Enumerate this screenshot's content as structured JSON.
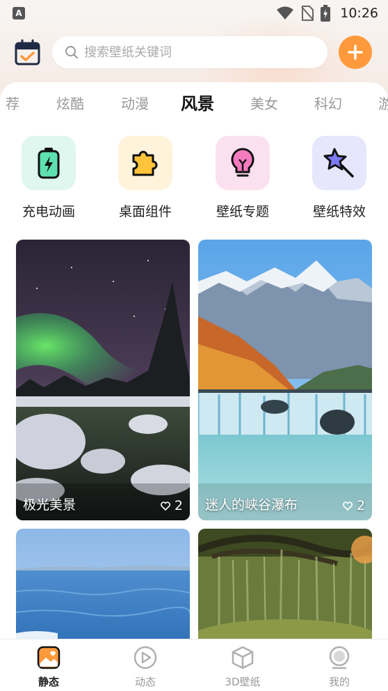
{
  "status_bar": {
    "time": "10:26",
    "app_badge": "A"
  },
  "search": {
    "placeholder": "搜索壁纸关键词",
    "value": ""
  },
  "tabs": [
    {
      "label": "荐",
      "active": false
    },
    {
      "label": "炫酷",
      "active": false
    },
    {
      "label": "动漫",
      "active": false
    },
    {
      "label": "风景",
      "active": true
    },
    {
      "label": "美女",
      "active": false
    },
    {
      "label": "科幻",
      "active": false
    },
    {
      "label": "游",
      "active": false
    }
  ],
  "quick": [
    {
      "label": "充电动画",
      "icon": "battery-charging-icon",
      "bg": "#dff7ee"
    },
    {
      "label": "桌面组件",
      "icon": "puzzle-icon",
      "bg": "#fff3dc"
    },
    {
      "label": "壁纸专题",
      "icon": "lightbulb-icon",
      "bg": "#fbe1ef"
    },
    {
      "label": "壁纸特效",
      "icon": "magic-wand-icon",
      "bg": "#e6e6fd"
    }
  ],
  "cards": [
    {
      "caption": "极光美景",
      "likes": "2"
    },
    {
      "caption": "迷人的峡谷瀑布",
      "likes": "2"
    },
    {
      "caption": "",
      "likes": ""
    },
    {
      "caption": "",
      "likes": ""
    }
  ],
  "nav": [
    {
      "label": "静态",
      "icon": "static-wallpaper-icon",
      "active": true
    },
    {
      "label": "动态",
      "icon": "play-circle-icon",
      "active": false
    },
    {
      "label": "3D壁纸",
      "icon": "cube-icon",
      "active": false
    },
    {
      "label": "我的",
      "icon": "profile-icon",
      "active": false
    }
  ],
  "colors": {
    "accent": "#ff9a3c",
    "tab_marker": "#ff8a5c"
  }
}
